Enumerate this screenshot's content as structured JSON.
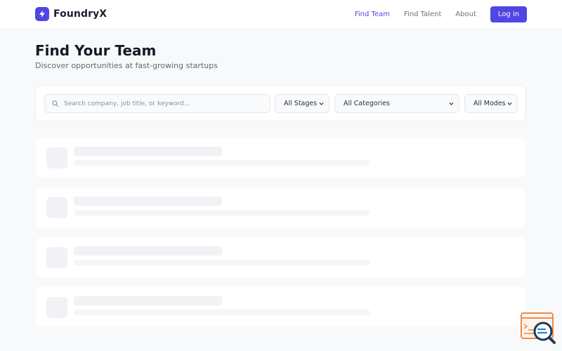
{
  "header": {
    "brand_name": "FoundryX",
    "nav": {
      "find_team": "Find Team",
      "find_talent": "Find Talent",
      "about": "About"
    },
    "login_label": "Log in"
  },
  "hero": {
    "title": "Find Your Team",
    "subtitle": "Discover opportunities at fast-growing startups"
  },
  "filters": {
    "search_placeholder": "Search company, job title, or keyword...",
    "stage_selected": "All Stages",
    "category_selected": "All Categories",
    "mode_selected": "All Modes"
  },
  "colors": {
    "accent": "#4f46e5",
    "background": "#f8f9fb",
    "skeleton": "#f1f2f5"
  },
  "icons": {
    "brand": "lightning-bolt-icon",
    "search": "search-icon",
    "dropdown": "chevron-down-icon"
  }
}
